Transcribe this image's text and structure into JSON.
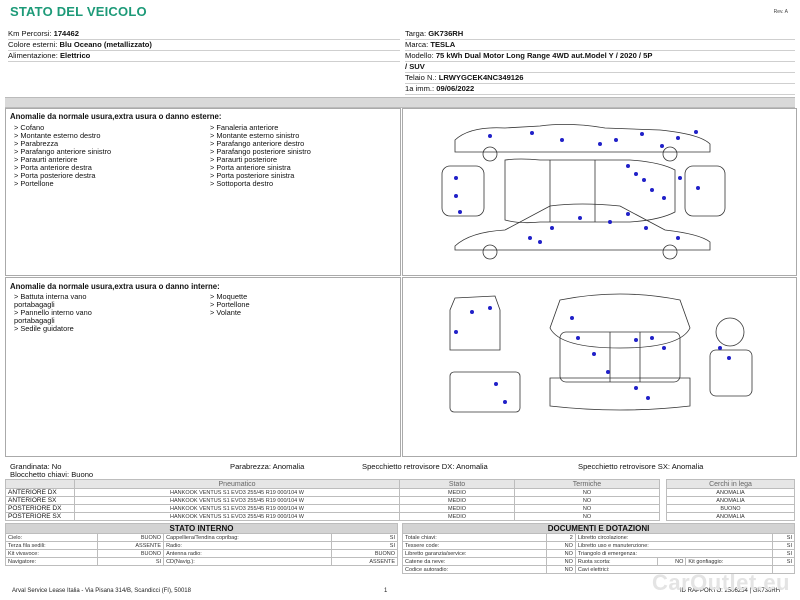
{
  "header": {
    "title": "STATO DEL VEICOLO",
    "rev": "Rev. A"
  },
  "left_info": [
    {
      "label": "Km Percorsi:",
      "value": "174462"
    },
    {
      "label": "Colore esterni:",
      "value": "Blu Oceano (metallizzato)"
    },
    {
      "label": "Alimentazione:",
      "value": "Elettrico"
    }
  ],
  "right_info": {
    "targa_label": "Targa:",
    "targa": "GK736RH",
    "marca_label": "Marca:",
    "marca": "TESLA",
    "modello_label": "Modello:",
    "modello_1": "75 kWh Dual Motor Long Range 4WD aut.Model Y / 2020 / 5P",
    "modello_2": "/ SUV",
    "telaio_label": "Telaio N.:",
    "telaio": "LRWYGCEK4NC349126",
    "imm_label": "1a imm.:",
    "imm": "09/06/2022"
  },
  "external": {
    "title": "Anomalie da normale usura,extra usura o danno esterne:",
    "col1": [
      "> Cofano",
      "> Montante esterno destro",
      "> Parabrezza",
      "> Parafango anteriore sinistro",
      "> Paraurti anteriore",
      "> Porta anteriore destra",
      "> Porta posteriore destra",
      "> Portellone"
    ],
    "col2": [
      "> Fanaleria anteriore",
      "> Montante esterno sinistro",
      "> Parafango anteriore destro",
      "> Parafango posteriore sinistro",
      "> Paraurti posteriore",
      "> Porta anteriore sinistra",
      "> Porta posteriore sinistra",
      "> Sottoporta destro"
    ]
  },
  "internal": {
    "title": "Anomalie da normale usura,extra usura o danno interne:",
    "col1": [
      "> Battuta interna vano",
      "portabagagli",
      "> Pannello interno vano",
      "portabagagli",
      "> Sedile guidatore"
    ],
    "col2": [
      "> Moquette",
      "> Portellone",
      "> Volante"
    ]
  },
  "summary": {
    "grandinata": "Grandinata: No",
    "bloccaggio": "Blocchetto chiavi: Buono",
    "parabrezza": "Parabrezza: Anomalia",
    "specchietto_dx": "Specchietto retrovisore DX: Anomalia",
    "specchietto_sx": "Specchietto retrovisore SX: Anomalia"
  },
  "tyres": {
    "headers": [
      "Pneumatico",
      "Stato",
      "Termiche"
    ],
    "rim_header": "Cerchi in lega",
    "rows": [
      {
        "pos": "ANTERIORE DX",
        "desc": "HANKOOK VENTUS S1 EVO3  255/45 R19 000/104 W",
        "stato": "MEDIO",
        "term": "NO",
        "rim": "ANOMALIA"
      },
      {
        "pos": "ANTERIORE SX",
        "desc": "HANKOOK VENTUS S1 EVO3  255/45 R19 000/104 W",
        "stato": "MEDIO",
        "term": "NO",
        "rim": "ANOMALIA"
      },
      {
        "pos": "POSTERIORE DX",
        "desc": "HANKOOK VENTUS S1 EVO3  255/45 R19 000/104 W",
        "stato": "MEDIO",
        "term": "NO",
        "rim": "BUONO"
      },
      {
        "pos": "POSTERIORE SX",
        "desc": "HANKOOK VENTUS S1 EVO3  255/45 R19 000/104 W",
        "stato": "MEDIO",
        "term": "NO",
        "rim": "ANOMALIA"
      }
    ]
  },
  "stato_interno": {
    "title": "STATO INTERNO",
    "rows": [
      [
        "Cielo:",
        "BUONO",
        "Cappelliera/Tendina copribag:",
        "SI"
      ],
      [
        "Terza fila sedili:",
        "ASSENTE",
        "Radio:",
        "SI"
      ],
      [
        "Kit vivavoce:",
        "BUONO",
        "Antenna radio:",
        "BUONO"
      ],
      [
        "Navigatore:",
        "SI",
        "CD(Navig.):",
        "ASSENTE"
      ]
    ]
  },
  "documenti": {
    "title": "DOCUMENTI E DOTAZIONI",
    "rows": [
      [
        "Totale chiavi:",
        "2",
        "Libretto circolazione:",
        "SI"
      ],
      [
        "Tessere code:",
        "NO",
        "Libretto uso e manutenzione:",
        "SI"
      ],
      [
        "Libretto garanzia/service:",
        "NO",
        "Triangolo di emergenza:",
        "SI"
      ],
      [
        "Catene da neve:",
        "NO",
        "Ruota scorta:",
        "NO",
        "Kit gonfiaggio:",
        "SI"
      ],
      [
        "Codice autoradio:",
        "NO",
        "Cavi elettrici:",
        ""
      ]
    ]
  },
  "footer": {
    "company": "Arval Service Lease Italia - Via Pisana 314/B, Scandicci (FI), 50018",
    "page": "1",
    "code": "ID RAPPORTO: 2506254 | GK736RH"
  },
  "watermark": "CarOutlet.eu",
  "colors": {
    "accent": "#1d9a78",
    "marker": "#2121c8"
  }
}
